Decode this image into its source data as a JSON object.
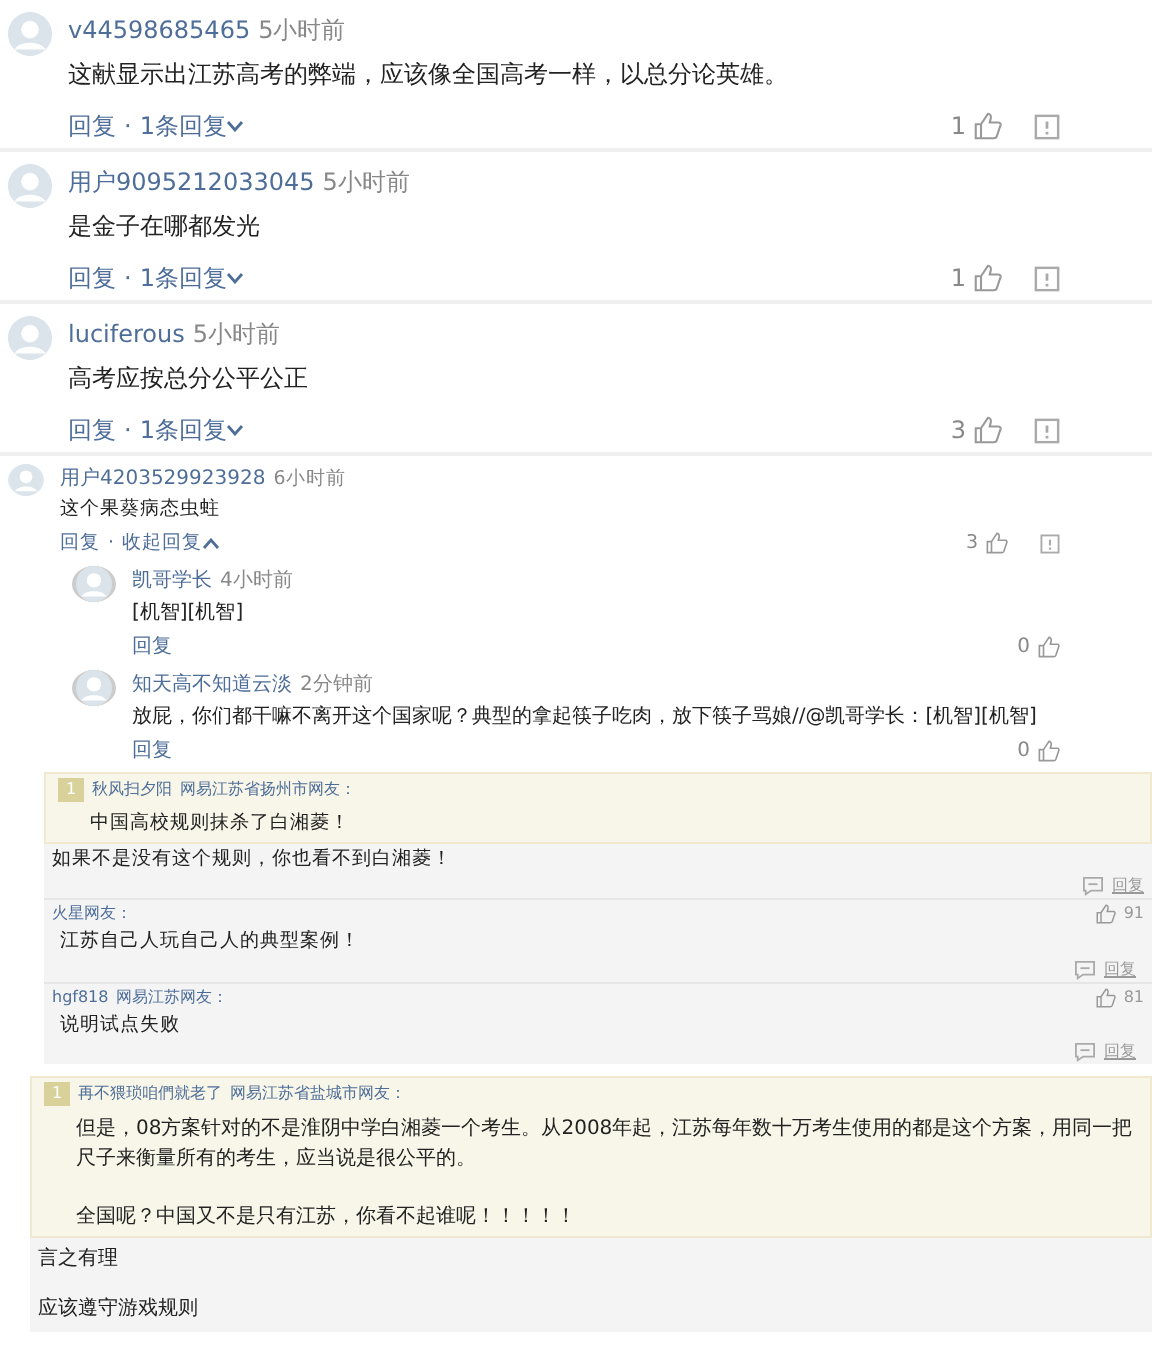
{
  "comments": [
    {
      "kind": "large",
      "user": "v44598685465",
      "time": "5小时前",
      "text": "这献显示出江苏高考的弊端，应该像全国高考一样，以总分论英雄。",
      "reply": "回复",
      "separator": "·",
      "reply_count": "1条回复",
      "expanded": false,
      "likes": "1"
    },
    {
      "kind": "large",
      "user": "用户9095212033045",
      "time": "5小时前",
      "text": "是金子在哪都发光",
      "reply": "回复",
      "separator": "·",
      "reply_count": "1条回复",
      "expanded": false,
      "likes": "1"
    },
    {
      "kind": "large",
      "user": "luciferous",
      "time": "5小时前",
      "text": "高考应按总分公平公正",
      "reply": "回复",
      "separator": "·",
      "reply_count": "1条回复",
      "expanded": false,
      "likes": "3"
    },
    {
      "kind": "compact",
      "user": "用户4203529923928",
      "time": "6小时前",
      "text": "这个果葵病态虫蛀",
      "reply": "回复",
      "separator": "·",
      "reply_count": "收起回复",
      "expanded": true,
      "likes": "3",
      "children": [
        {
          "user": "凯哥学长",
          "time": "4小时前",
          "text": "[机智][机智]",
          "reply": "回复",
          "likes": "0"
        },
        {
          "user": "知天高不知道云淡",
          "time": "2分钟前",
          "text": "放屁，你们都干嘛不离开这个国家呢？典型的拿起筷子吃肉，放下筷子骂娘//@凯哥学长：[机智][机智]",
          "reply": "回复",
          "likes": "0"
        }
      ]
    }
  ],
  "thread": [
    {
      "quote": {
        "floor": "1",
        "user": "秋风扫夕阳",
        "location": "网易江苏省扬州市网友：",
        "text": "中国高校规则抹杀了白湘菱！"
      },
      "text": "如果不是没有这个规则，你也看不到白湘菱！",
      "reply": "回复"
    },
    {
      "user": "火星网友：",
      "likes": "91",
      "text": "江苏自己人玩自己人的典型案例！",
      "reply": "回复"
    },
    {
      "user": "hgf818",
      "location": "网易江苏网友：",
      "likes": "81",
      "text": "说明试点失败",
      "reply": "回复"
    }
  ],
  "thread2": {
    "quote": {
      "floor": "1",
      "user": "再不猥琐咱們就老了",
      "location": "网易江苏省盐城市网友：",
      "paragraphs": [
        "但是，08方案针对的不是淮阴中学白湘菱一个考生。从2008年起，江苏每年数十万考生使用的都是这个方案，用同一把尺子来衡量所有的考生，应当说是很公平的。",
        "全国呢？中国又不是只有江苏，你看不起谁呢！！！！！"
      ]
    },
    "lines": [
      "言之有理",
      "应该遵守游戏规则"
    ]
  }
}
